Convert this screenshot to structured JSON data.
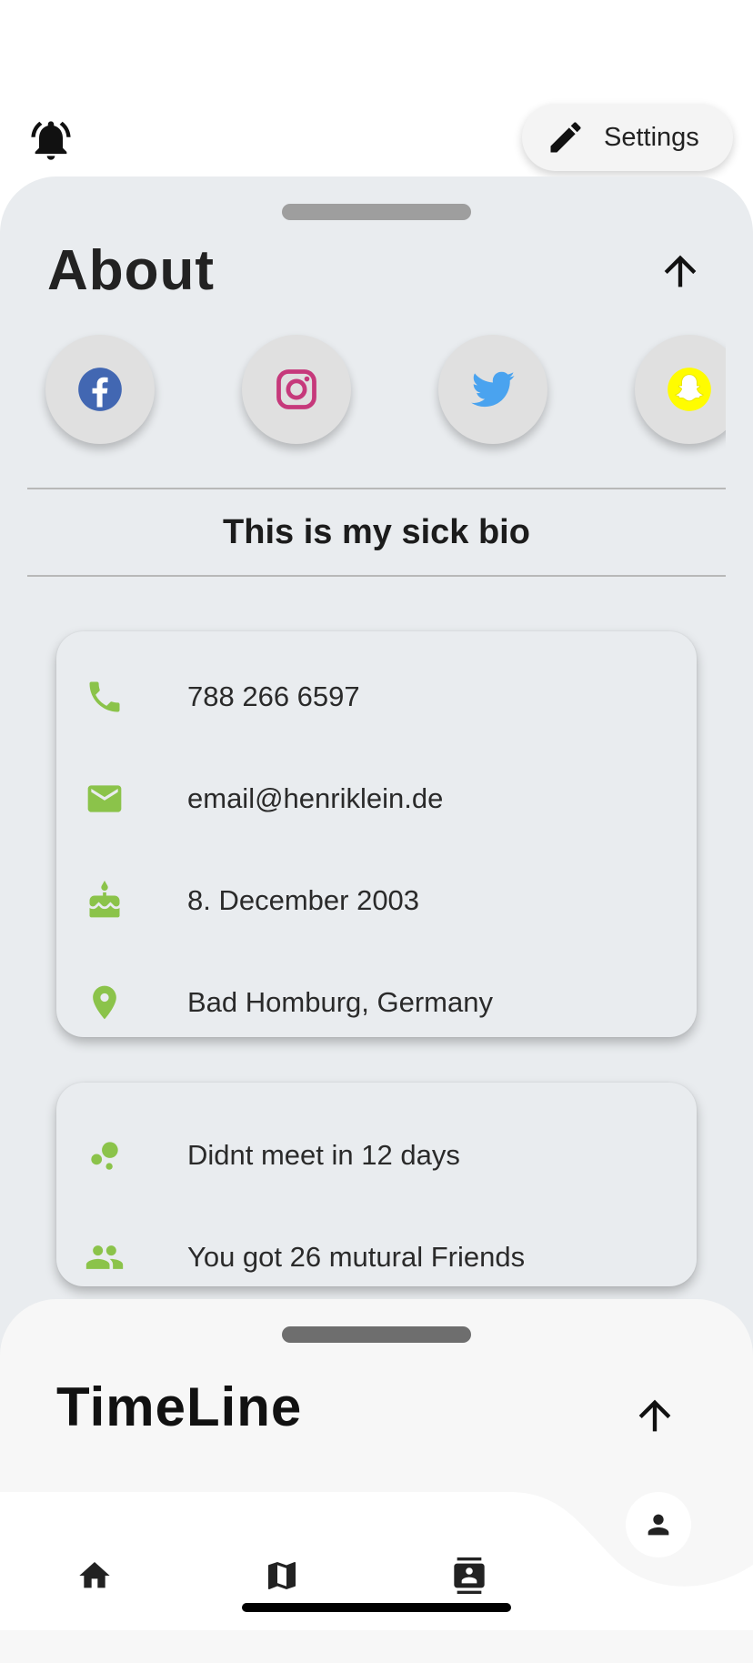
{
  "header": {
    "bell_icon": "notifications-active-icon",
    "settings_label": "Settings"
  },
  "about": {
    "title": "About",
    "socials": [
      {
        "name": "facebook",
        "icon": "facebook-icon",
        "color": "#3b5998"
      },
      {
        "name": "instagram",
        "icon": "instagram-icon",
        "color": "#c13584"
      },
      {
        "name": "twitter",
        "icon": "twitter-icon",
        "color": "#1da1f2"
      },
      {
        "name": "snapchat",
        "icon": "snapchat-icon",
        "color": "#fffc00"
      }
    ],
    "bio": "This is my sick bio",
    "contact": {
      "phone": "788 266 6597",
      "email": "email@henriklein.de",
      "birthday": "8. December 2003",
      "location": "Bad Homburg, Germany"
    },
    "stats": {
      "last_met": "Didnt meet in 12 days",
      "mutual_friends": "You got 26 mutural Friends"
    },
    "accent_color": "#8bc34a"
  },
  "timeline": {
    "title": "TimeLine"
  },
  "nav": {
    "items": [
      "home-icon",
      "map-icon",
      "contacts-icon"
    ],
    "fab": "person-icon"
  }
}
